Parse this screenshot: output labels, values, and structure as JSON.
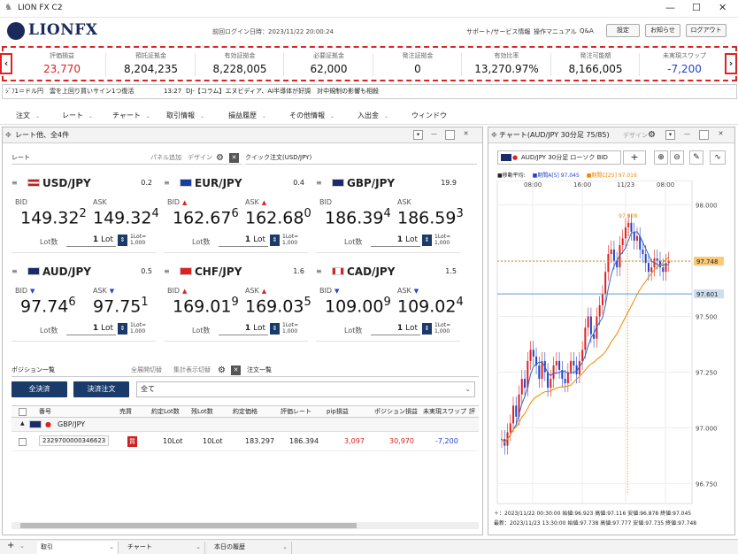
{
  "window": {
    "title": "LION FX C2",
    "minimize": "—",
    "maximize": "☐",
    "close": "✕"
  },
  "header": {
    "brand": "LIONFX",
    "last_login": "前回ログイン日時：2023/11/22 20:00:24",
    "links": [
      "サポート/サービス情報",
      "操作マニュアル",
      "Q&A"
    ],
    "buttons": [
      "設定",
      "お知らせ",
      "ログアウト"
    ]
  },
  "summary": [
    {
      "label": "評価損益",
      "value": "23,770",
      "color": "#d22"
    },
    {
      "label": "預託証拠金",
      "value": "8,204,235",
      "color": "#111"
    },
    {
      "label": "有効証拠金",
      "value": "8,228,005",
      "color": "#111"
    },
    {
      "label": "必要証拠金",
      "value": "62,000",
      "color": "#111"
    },
    {
      "label": "発注証拠金",
      "value": "0",
      "color": "#111"
    },
    {
      "label": "有効比率",
      "value": "13,270.97%",
      "color": "#111"
    },
    {
      "label": "発注可能額",
      "value": "8,166,005",
      "color": "#111"
    },
    {
      "label": "未実現スワップ",
      "value": "-7,200",
      "color": "#24c"
    }
  ],
  "ticker": {
    "left": "ｼﾞﾌ1＝ドル円　雲を上回り買いサイン1つ復活",
    "time": "13:27",
    "right": "DJ-【コラム】エヌビディア、AI半導体が好調　対中規制の影響も相殺"
  },
  "menu": [
    "注文",
    "レート",
    "チャート",
    "取引情報",
    "損益履歴",
    "その他情報",
    "入出金",
    "ウィンドウ"
  ],
  "rate_panel": {
    "title": "レート他、全4件",
    "tab": "レート",
    "panel_add": "パネル追加",
    "design": "デザイン",
    "quick_order": "クイック注文(USD/JPY)"
  },
  "rates": [
    {
      "pair": "USD/JPY",
      "spread": "0.2",
      "bid_main": "149.32",
      "bid_sub": "2",
      "ask_main": "149.32",
      "ask_sub": "4",
      "bid_dir": "",
      "ask_dir": "",
      "lot": "1",
      "flag": "us"
    },
    {
      "pair": "EUR/JPY",
      "spread": "0.4",
      "bid_main": "162.67",
      "bid_sub": "6",
      "ask_main": "162.68",
      "ask_sub": "0",
      "bid_dir": "▲",
      "ask_dir": "▲",
      "lot": "1",
      "flag": "eu"
    },
    {
      "pair": "GBP/JPY",
      "spread": "19.9",
      "bid_main": "186.39",
      "bid_sub": "4",
      "ask_main": "186.59",
      "ask_sub": "3",
      "bid_dir": "",
      "ask_dir": "",
      "lot": "1",
      "flag": "gb"
    },
    {
      "pair": "AUD/JPY",
      "spread": "0.5",
      "bid_main": "97.74",
      "bid_sub": "6",
      "ask_main": "97.75",
      "ask_sub": "1",
      "bid_dir": "▼",
      "ask_dir": "▼",
      "lot": "1",
      "flag": "au"
    },
    {
      "pair": "CHF/JPY",
      "spread": "1.6",
      "bid_main": "169.01",
      "bid_sub": "9",
      "ask_main": "169.03",
      "ask_sub": "5",
      "bid_dir": "▲",
      "ask_dir": "▲",
      "lot": "1",
      "flag": "ch"
    },
    {
      "pair": "CAD/JPY",
      "spread": "1.5",
      "bid_main": "109.00",
      "bid_sub": "9",
      "ask_main": "109.02",
      "ask_sub": "4",
      "bid_dir": "▼",
      "ask_dir": "▼",
      "lot": "1",
      "flag": "ca"
    }
  ],
  "labels": {
    "bid": "BID",
    "ask": "ASK",
    "lot": "Lot数",
    "lot_unit": "Lot",
    "lot_eq1": "1Lot=",
    "lot_eq2": "1,000"
  },
  "positions": {
    "title": "ポジション一覧",
    "expand": "全展開切替",
    "agg": "集計表示切替",
    "order_tab": "注文一覧",
    "settle_all": "全決済",
    "settle_order": "決済注文",
    "filter": "全て",
    "columns": [
      "番号",
      "売買",
      "約定Lot数",
      "残Lot数",
      "約定価格",
      "評価レート",
      "pip損益",
      "ポジション損益",
      "未実現スワップ",
      "評"
    ],
    "group": "GBP/JPY",
    "row": {
      "id": "2329700000346623",
      "side": "買",
      "lots": "10Lot",
      "remain": "10Lot",
      "price": "183.297",
      "rate": "186.394",
      "pip": "3,097",
      "pl": "30,970",
      "swap": "-7,200"
    }
  },
  "chart": {
    "title": "チャート(AUD/JPY 30分足 75/85)",
    "design": "デザイン",
    "symbol": "AUD/JPY 30分足 ローソク BID",
    "legend": [
      "■移動平均:",
      "■期間A[5] 97.045",
      "■期間C[25] 97.016"
    ],
    "time_labels": [
      "08:00",
      "16:00",
      "11/23",
      "08:00"
    ],
    "y_labels": [
      "98.000",
      "97.750",
      "97.500",
      "97.250",
      "97.000",
      "96.750"
    ],
    "price_tags": {
      "ask": "97.748",
      "bid": "97.601",
      "high": "97.928"
    },
    "footer1": "＋：2023/11/22 00:30:00 始値:96.923 高値:97.116 安値:96.878 終値:97.045",
    "footer2": "最新：2023/11/23 13:30:00 始値:97.738 高値:97.777 安値:97.735 終値:97.748"
  },
  "bottom_tabs": [
    "取引",
    "チャート",
    "本日の履歴"
  ]
}
